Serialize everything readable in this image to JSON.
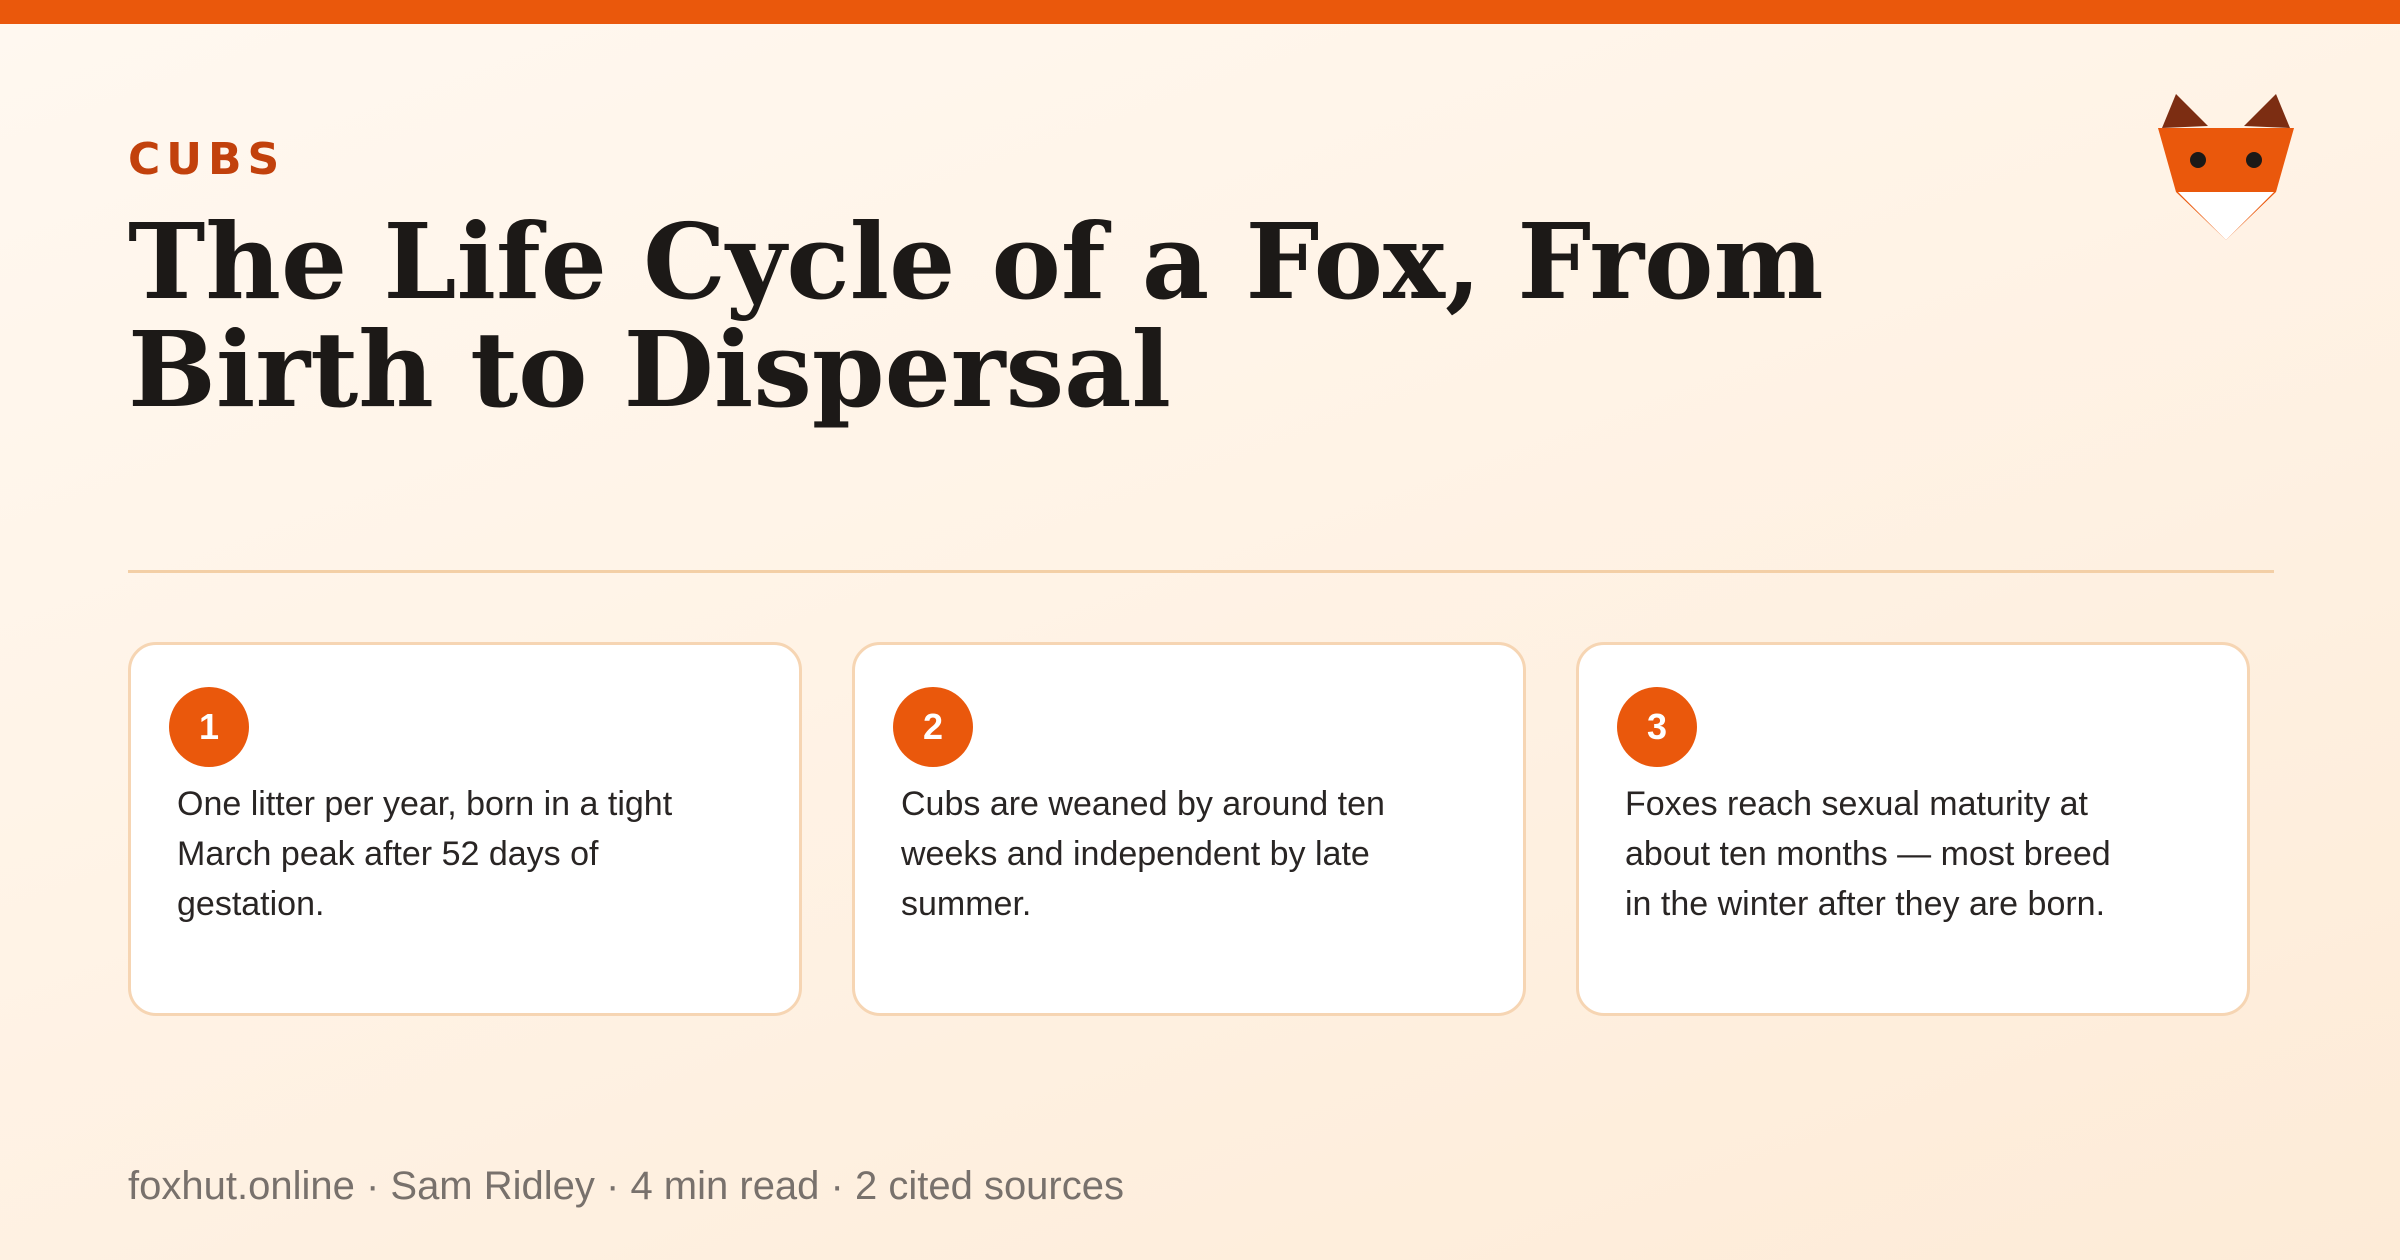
{
  "header": {
    "kicker": "CUBS",
    "title": "The Life Cycle of a Fox, From Birth to Dispersal",
    "logo_icon": "fox-head-icon"
  },
  "cards": [
    {
      "number": "1",
      "text": "One litter per year, born in a tight March peak after 52 days of gestation."
    },
    {
      "number": "2",
      "text": "Cubs are weaned by around ten weeks and independent by late summer."
    },
    {
      "number": "3",
      "text": "Foxes reach sexual maturity at about ten months — most breed in the winter after they are born."
    }
  ],
  "footer": {
    "byline": "foxhut.online · Sam Ridley · 4 min read · 2 cited sources"
  },
  "colors": {
    "accent": "#ea580c",
    "kicker": "#c2410c",
    "fox_orange": "#ea580c",
    "fox_dark": "#7c2d12",
    "card_border": "#f6d5b3"
  }
}
